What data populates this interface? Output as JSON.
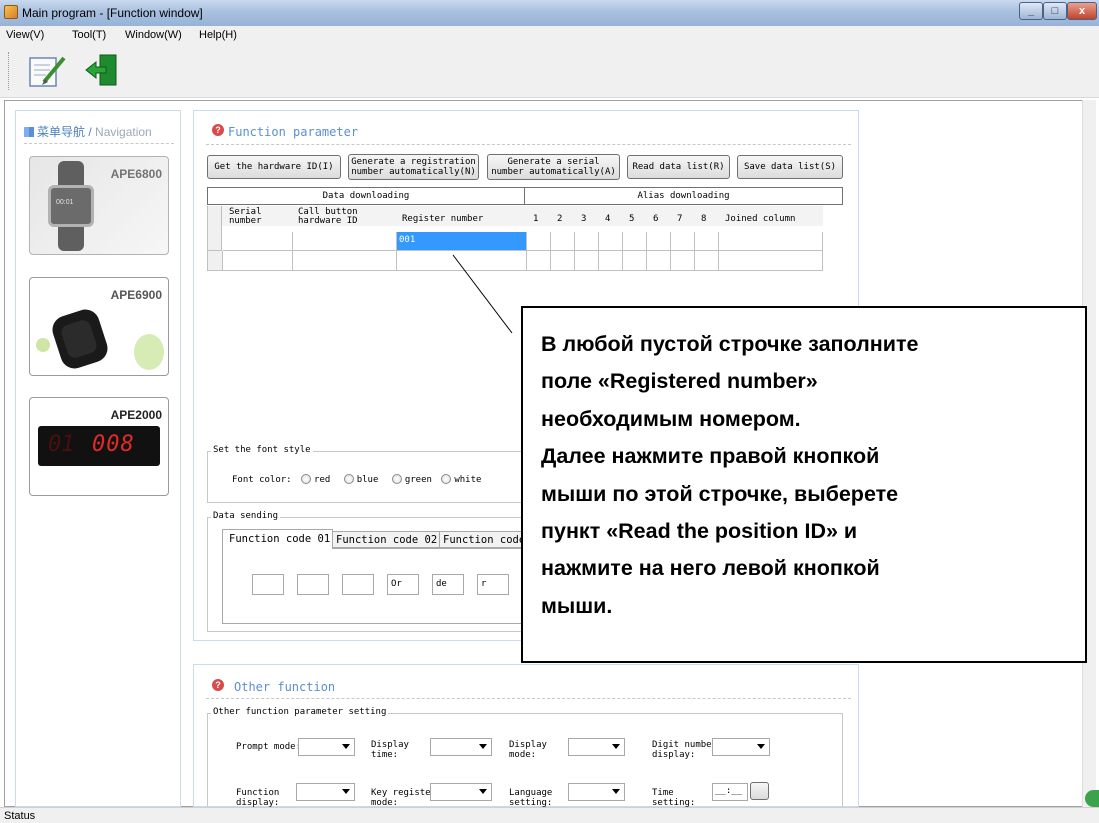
{
  "window": {
    "title": "Main program - [Function window]",
    "min": "_",
    "max": "□",
    "close": "x"
  },
  "menu": [
    "View(V)",
    "Tool(T)",
    "Window(W)",
    "Help(H)"
  ],
  "nav": {
    "header_cn": "菜单导航",
    "header_sep": " / ",
    "header_en": "Navigation",
    "products": [
      {
        "name": "APE6800",
        "screen": "00:01"
      },
      {
        "name": "APE6900"
      },
      {
        "name": "APE2000",
        "digits": "008",
        "digits_dim": "01"
      }
    ]
  },
  "function_parameter": {
    "title": "Function parameter",
    "buttons": {
      "hardware_id": "Get the hardware ID(I)",
      "gen_reg_1": "Generate a registration",
      "gen_reg_2": "number automatically(N)",
      "gen_serial_1": "Generate a serial",
      "gen_serial_2": "number automatically(A)",
      "read_list": "Read data list(R)",
      "save_list": "Save data list(S)"
    },
    "grid": {
      "group_data": "Data downloading",
      "group_alias": "Alias downloading",
      "col_serial_1": "Serial",
      "col_serial_2": "number",
      "col_hw_1": "Call button",
      "col_hw_2": "hardware ID",
      "col_reg": "Register number",
      "col_nums": [
        "1",
        "2",
        "3",
        "4",
        "5",
        "6",
        "7",
        "8"
      ],
      "col_joined": "Joined column",
      "row1_reg": "001"
    }
  },
  "font_style": {
    "group": "Set the font style",
    "label": "Font color:",
    "options": [
      "red",
      "blue",
      "green",
      "white"
    ]
  },
  "data_sending": {
    "group": "Data sending",
    "tabs": [
      "Function code 01",
      "Function code 02",
      "Function code"
    ],
    "boxes": [
      "",
      "",
      "",
      "Or",
      "de",
      "r"
    ]
  },
  "other_function": {
    "title": "Other function",
    "group": "Other function parameter setting",
    "labels": {
      "prompt": "Prompt mode:",
      "display_time_1": "Display",
      "display_time_2": "time:",
      "display_mode_1": "Display",
      "display_mode_2": "mode:",
      "digit_1": "Digit number",
      "digit_2": "display:",
      "func_disp_1": "Function",
      "func_disp_2": "display:",
      "keyreg_1": "Key register",
      "keyreg_2": "mode:",
      "lang_1": "Language",
      "lang_2": "setting:",
      "time_1": "Time",
      "time_2": "setting:",
      "time_value": "__:__"
    }
  },
  "callout": {
    "lines": [
      "В любой пустой строчке заполните",
      "поле «Registered number»",
      "необходимым номером.",
      "Далее нажмите правой кнопкой",
      "мыши по этой строчке, выберете",
      "пункт «Read the position ID» и",
      "нажмите на него левой кнопкой",
      "мыши."
    ]
  },
  "status": "Status"
}
